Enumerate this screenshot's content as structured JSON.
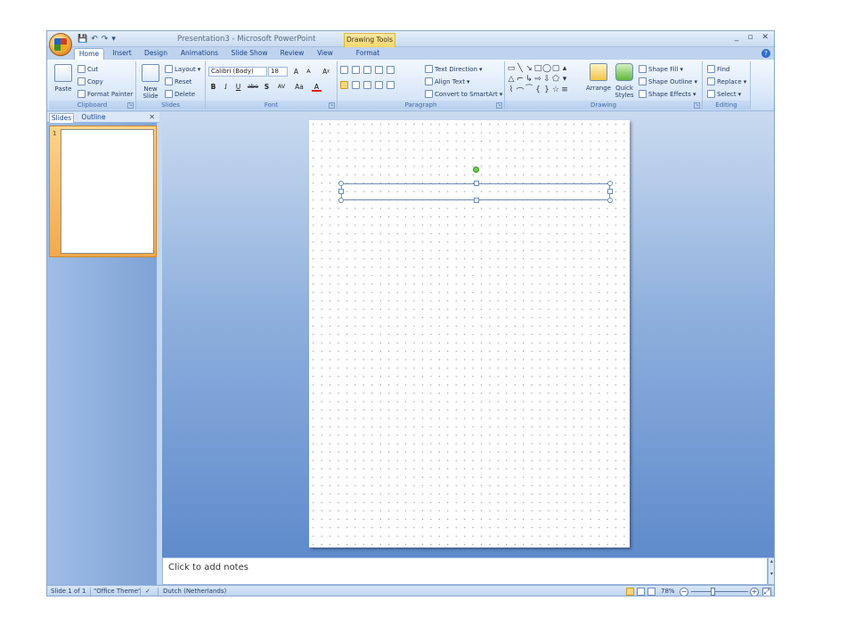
{
  "window": {
    "title": "Presentation3 - Microsoft PowerPoint",
    "context_tab_group": "Drawing Tools",
    "controls": [
      "_",
      "▫",
      "✕"
    ]
  },
  "quick_access": {
    "save": "💾",
    "undo": "↶",
    "redo": "↷",
    "more": "▾"
  },
  "tabs": [
    "Home",
    "Insert",
    "Design",
    "Animations",
    "Slide Show",
    "Review",
    "View",
    "Format"
  ],
  "active_tab": "Home",
  "ribbon": {
    "clipboard": {
      "label": "Clipboard",
      "paste": "Paste",
      "cut": "Cut",
      "copy": "Copy",
      "format_painter": "Format Painter"
    },
    "slides": {
      "label": "Slides",
      "new_slide": "New Slide",
      "layout": "Layout",
      "reset": "Reset",
      "delete": "Delete"
    },
    "font": {
      "label": "Font",
      "font_name": "Calibri (Body)",
      "font_size": "18",
      "grow": "A",
      "shrink": "A",
      "clear": "Aᵡ",
      "bold": "B",
      "italic": "I",
      "underline": "U",
      "strike": "abe",
      "shadow": "S",
      "spacing": "AV",
      "case": "Aa",
      "color": "A"
    },
    "paragraph": {
      "label": "Paragraph",
      "text_direction": "Text Direction",
      "align_text": "Align Text",
      "convert_smartart": "Convert to SmartArt"
    },
    "drawing": {
      "label": "Drawing",
      "arrange": "Arrange",
      "quick_styles": "Quick Styles",
      "shape_fill": "Shape Fill",
      "shape_outline": "Shape Outline",
      "shape_effects": "Shape Effects"
    },
    "editing": {
      "label": "Editing",
      "find": "Find",
      "replace": "Replace",
      "select": "Select"
    }
  },
  "slides_pane": {
    "tabs": [
      "Slides",
      "Outline"
    ],
    "close": "✕",
    "thumbnail_number": "1"
  },
  "notes": {
    "placeholder": "Click to add notes"
  },
  "status": {
    "slide": "Slide 1 of 1",
    "theme": "\"Office Theme\"",
    "language": "Dutch (Netherlands)",
    "zoom": "78%"
  },
  "colors": {
    "accent": "#15428b",
    "ribbon": "#d7e6f8",
    "canvas": "#5f8bcc"
  }
}
